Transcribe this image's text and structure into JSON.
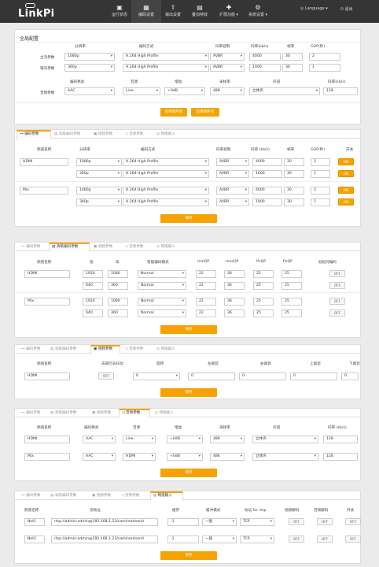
{
  "nav": {
    "brand": "LinkPi",
    "items": [
      {
        "label": "运行状态",
        "icon": "▣"
      },
      {
        "label": "编码设置",
        "icon": "▦"
      },
      {
        "label": "输出设置",
        "icon": "⇧"
      },
      {
        "label": "叠加特效",
        "icon": "▤"
      },
      {
        "label": "扩展功能",
        "icon": "✚"
      },
      {
        "label": "系统设置",
        "icon": "⚙"
      }
    ],
    "language": "Language",
    "logout": "退出"
  },
  "global": {
    "title": "全局配置",
    "vheaders": [
      "分辨率",
      "编码方式",
      "码率控制",
      "码率(kb/s)",
      "帧率",
      "GOP(秒)"
    ],
    "vrows": [
      {
        "label": "主流参数",
        "res": "1080p",
        "codec": "H.264 High Profile",
        "rc": "AVBR",
        "bitrate": "4000",
        "fps": "30",
        "gop": "2"
      },
      {
        "label": "辅流参数",
        "res": "360p",
        "codec": "H.264 High Profile",
        "rc": "AVBR",
        "bitrate": "1000",
        "fps": "30",
        "gop": "1"
      }
    ],
    "aheaders": [
      "编码格式",
      "音源",
      "增益",
      "采样率",
      "声道",
      "码率(kb/s)"
    ],
    "arow": {
      "label": "音频参数",
      "fmt": "AAC",
      "src": "Line",
      "gain": "+0dB",
      "rate": "48K",
      "ch": "立体声",
      "bitrate": "128"
    },
    "btn1": "应用到所有",
    "btn2": "应用到所有"
  },
  "tabs": [
    "编码参数",
    "高级编码参数",
    "视频参数",
    "音频参数",
    "网络输入"
  ],
  "enc": {
    "headers": [
      "频道名称",
      "分辨率",
      "编码方式",
      "码率控制",
      "码率 (kb/s)",
      "帧率",
      "GOP(秒)",
      "开关"
    ],
    "channels": [
      {
        "name": "HDMI",
        "rows": [
          {
            "res": "1080p",
            "codec": "H.264 High Profile",
            "rc": "AVBR",
            "bitrate": "4000",
            "fps": "30",
            "gop": "2",
            "sw": "ON"
          },
          {
            "res": "360p",
            "codec": "H.264 High Profile",
            "rc": "AVBR",
            "bitrate": "1000",
            "fps": "30",
            "gop": "1",
            "sw": "ON"
          }
        ]
      },
      {
        "name": "Mix",
        "rows": [
          {
            "res": "1080p",
            "codec": "H.264 High Profile",
            "rc": "AVBR",
            "bitrate": "4000",
            "fps": "30",
            "gop": "2",
            "sw": "ON"
          },
          {
            "res": "360p",
            "codec": "H.264 High Profile",
            "rc": "AVBR",
            "bitrate": "1000",
            "fps": "30",
            "gop": "1",
            "sw": "ON"
          }
        ]
      }
    ],
    "save": "保存"
  },
  "adv": {
    "headers": [
      "频道名称",
      "宽",
      "高",
      "智能编码模式",
      "minQP",
      "maxQP",
      "IfxQP",
      "PxQP",
      "低延时编码"
    ],
    "channels": [
      {
        "name": "HDMI",
        "rows": [
          {
            "w": "1920",
            "h": "1080",
            "mode": "Normal",
            "min": "22",
            "max": "36",
            "i": "25",
            "p": "25",
            "sw": "OFF"
          },
          {
            "w": "640",
            "h": "360",
            "mode": "Normal",
            "min": "22",
            "max": "36",
            "i": "25",
            "p": "25",
            "sw": "OFF"
          }
        ]
      },
      {
        "name": "Mix",
        "rows": [
          {
            "w": "1920",
            "h": "1080",
            "mode": "Normal",
            "min": "22",
            "max": "36",
            "i": "25",
            "p": "25",
            "sw": "OFF"
          },
          {
            "w": "640",
            "h": "360",
            "mode": "Normal",
            "min": "22",
            "max": "36",
            "i": "25",
            "p": "25",
            "sw": "OFF"
          }
        ]
      }
    ],
    "save": "保存"
  },
  "video": {
    "headers": [
      "频道名称",
      "去隔行去抖动",
      "旋转",
      "左裁剪",
      "右裁剪",
      "上裁剪",
      "下裁剪"
    ],
    "row": {
      "name": "HDMI",
      "deint": "OFF",
      "rot": "0",
      "l": "0",
      "r": "0",
      "t": "0",
      "b": "0"
    },
    "save": "保存"
  },
  "audio": {
    "headers": [
      "频道名称",
      "编码格式",
      "音源",
      "增益",
      "采样率",
      "声道",
      "码率 (kb/s)"
    ],
    "rows": [
      {
        "name": "HDMI",
        "fmt": "AAC",
        "src": "Line",
        "gain": "+0dB",
        "rate": "48K",
        "ch": "立体声",
        "bitrate": "128"
      },
      {
        "name": "Mix",
        "fmt": "AAC",
        "src": "HDMI",
        "gain": "+0dB",
        "rate": "48K",
        "ch": "立体声",
        "bitrate": "128"
      }
    ],
    "save": "保存"
  },
  "net": {
    "headers": [
      "频道名称",
      "流地址",
      "缓存",
      "缓冲模式",
      "协议 for rtsp",
      "视频解码",
      "音频解码",
      "开关"
    ],
    "rows": [
      {
        "name": "Net1",
        "url": "rtsp://admin:admin@192.168.1.23/cam/realmonit",
        "cache": "-1",
        "mode": "一般",
        "proto": "TCP",
        "vd": "OFF",
        "ad": "OFF",
        "sw": "OFF"
      },
      {
        "name": "Net2",
        "url": "rtsp://admin:admin@192.168.1.23/cam/realmonit",
        "cache": "-1",
        "mode": "一般",
        "proto": "TCP",
        "vd": "OFF",
        "ad": "OFF",
        "sw": "OFF"
      }
    ],
    "save": "保存"
  },
  "colors": {
    "accent": "#f5a300",
    "nav_bg": "#353535"
  }
}
